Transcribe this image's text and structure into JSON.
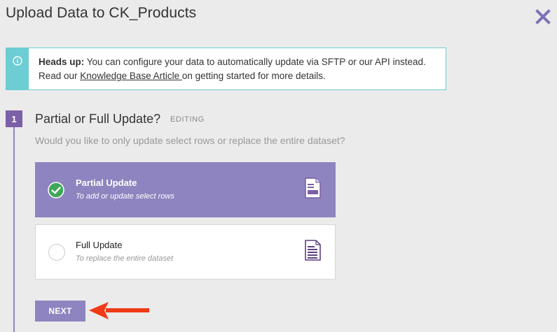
{
  "dialog": {
    "title": "Upload Data to CK_Products"
  },
  "alert": {
    "heads_up_label": "Heads up:",
    "line1_rest": " You can configure your data to automatically update via SFTP or our API instead.",
    "line2_before": "Read our ",
    "link_text": "Knowledge Base Article ",
    "line2_after": "on getting started for more details."
  },
  "step": {
    "number": "1",
    "title": "Partial or Full Update?",
    "status": "EDITING",
    "question": "Would you like to only update select rows or replace the entire dataset?"
  },
  "options": [
    {
      "title": "Partial Update",
      "subtitle": "To add or update select rows",
      "selected": true
    },
    {
      "title": "Full Update",
      "subtitle": "To replace the entire dataset",
      "selected": false
    }
  ],
  "actions": {
    "next_label": "NEXT"
  },
  "colors": {
    "accent": "#8e84bf",
    "step_badge": "#7b5fa7",
    "info": "#6ccdd3",
    "check": "#3fa75a",
    "annotation_arrow": "#f03a17"
  },
  "icons": {
    "close": "close-icon",
    "info": "info-icon",
    "check": "check-circle-icon",
    "document": "document-icon",
    "annotation": "red-arrow-icon"
  }
}
